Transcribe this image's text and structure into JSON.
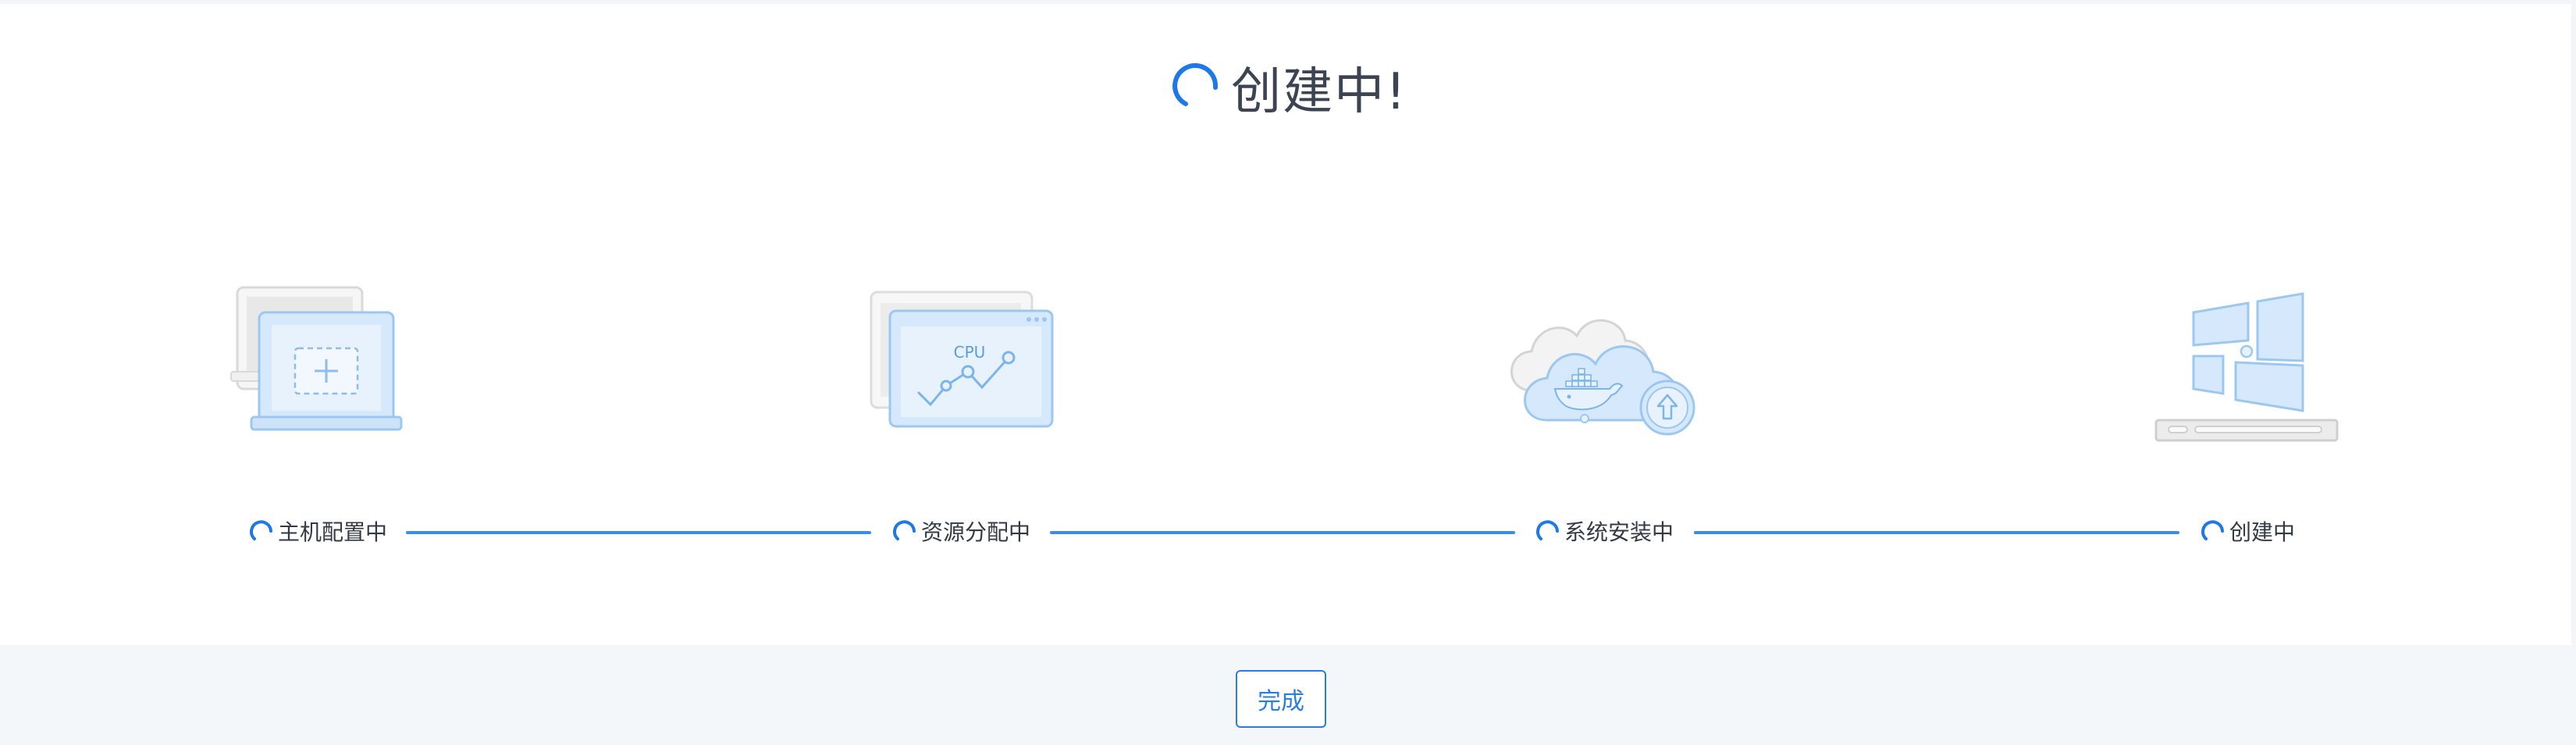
{
  "header": {
    "title": "创建中!",
    "status_icon": "loading-spinner-icon"
  },
  "steps": [
    {
      "label": "主机配置中",
      "illustration": "laptop-add-icon",
      "status_icon": "loading-spinner-icon"
    },
    {
      "label": "资源分配中",
      "illustration": "cpu-monitor-icon",
      "cpu_text": "CPU",
      "status_icon": "loading-spinner-icon"
    },
    {
      "label": "系统安装中",
      "illustration": "cloud-docker-upload-icon",
      "status_icon": "loading-spinner-icon"
    },
    {
      "label": "创建中",
      "illustration": "windows-server-icon",
      "status_icon": "loading-spinner-icon"
    }
  ],
  "footer": {
    "finish_label": "完成"
  },
  "colors": {
    "accent": "#2b7de0",
    "line": "#3b8ee6",
    "illus_fill": "#d6e8fb",
    "illus_stroke": "#9cc8f0",
    "title": "#3c4454"
  }
}
